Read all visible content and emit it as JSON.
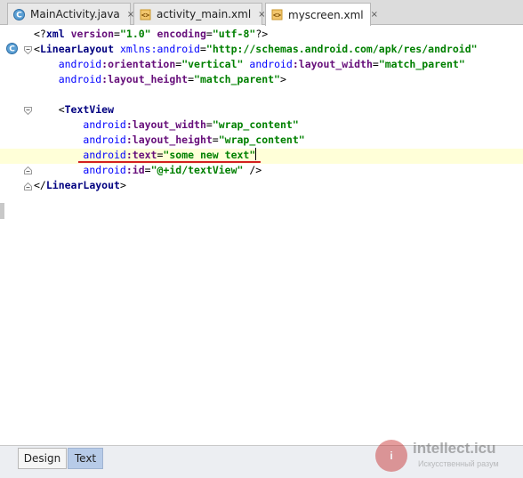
{
  "tabs": [
    {
      "label": "MainActivity.java",
      "icon": "java-class-icon",
      "active": false
    },
    {
      "label": "activity_main.xml",
      "icon": "xml-layout-icon",
      "active": false
    },
    {
      "label": "myscreen.xml",
      "icon": "xml-layout-icon",
      "active": true
    }
  ],
  "tab_close_glyph": "×",
  "editor": {
    "lines": [
      {
        "parts": [
          [
            "p",
            "<?"
          ],
          [
            "t",
            "xml "
          ],
          [
            "a",
            "version"
          ],
          [
            "p",
            "="
          ],
          [
            "v",
            "\"1.0\""
          ],
          [
            "p",
            " "
          ],
          [
            "a",
            "encoding"
          ],
          [
            "p",
            "="
          ],
          [
            "v",
            "\"utf-8\""
          ],
          [
            "p",
            "?>"
          ]
        ]
      },
      {
        "parts": [
          [
            "p",
            "<"
          ],
          [
            "t",
            "LinearLayout "
          ],
          [
            "an",
            "xmlns:android"
          ],
          [
            "p",
            "="
          ],
          [
            "v",
            "\"http://schemas.android.com/apk/res/android\""
          ]
        ]
      },
      {
        "parts": [
          [
            "p",
            "    "
          ],
          [
            "an",
            "android"
          ],
          [
            "a",
            ":orientation"
          ],
          [
            "p",
            "="
          ],
          [
            "v",
            "\"vertical\""
          ],
          [
            "p",
            " "
          ],
          [
            "an",
            "android"
          ],
          [
            "a",
            ":layout_width"
          ],
          [
            "p",
            "="
          ],
          [
            "v",
            "\"match_parent\""
          ]
        ]
      },
      {
        "parts": [
          [
            "p",
            "    "
          ],
          [
            "an",
            "android"
          ],
          [
            "a",
            ":layout_height"
          ],
          [
            "p",
            "="
          ],
          [
            "v",
            "\"match_parent\""
          ],
          [
            "p",
            ">"
          ]
        ]
      },
      {
        "parts": [
          [
            "p",
            ""
          ]
        ]
      },
      {
        "parts": [
          [
            "p",
            "    <"
          ],
          [
            "t",
            "TextView"
          ]
        ]
      },
      {
        "parts": [
          [
            "p",
            "        "
          ],
          [
            "an",
            "android"
          ],
          [
            "a",
            ":layout_width"
          ],
          [
            "p",
            "="
          ],
          [
            "v",
            "\"wrap_content\""
          ]
        ]
      },
      {
        "parts": [
          [
            "p",
            "        "
          ],
          [
            "an",
            "android"
          ],
          [
            "a",
            ":layout_height"
          ],
          [
            "p",
            "="
          ],
          [
            "v",
            "\"wrap_content\""
          ]
        ]
      },
      {
        "parts": [
          [
            "p",
            "        "
          ],
          [
            "an",
            "android"
          ],
          [
            "a",
            ":text"
          ],
          [
            "p",
            "="
          ],
          [
            "v",
            "\"some new text\""
          ]
        ]
      },
      {
        "parts": [
          [
            "p",
            "        "
          ],
          [
            "an",
            "android"
          ],
          [
            "a",
            ":id"
          ],
          [
            "p",
            "="
          ],
          [
            "v",
            "\"@+id/textView\""
          ],
          [
            "p",
            " />"
          ]
        ]
      },
      {
        "parts": [
          [
            "p",
            "</"
          ],
          [
            "t",
            "LinearLayout"
          ],
          [
            "p",
            ">"
          ]
        ]
      }
    ],
    "highlight_line": 9,
    "caret_line": 9
  },
  "bottom_tabs": [
    {
      "label": "Design",
      "active": false
    },
    {
      "label": "Text",
      "active": true
    }
  ],
  "watermark": {
    "name": "intellect.icu",
    "sub": "Искусственный разум",
    "badge": "i"
  },
  "colors": {
    "tag": "#000080",
    "attribute": "#660e7a",
    "namespace": "#0000ff",
    "value": "#008000",
    "highlight": "#ffffd8",
    "error_underline": "#d32020",
    "active_bottom_tab": "#b7cbe8"
  }
}
